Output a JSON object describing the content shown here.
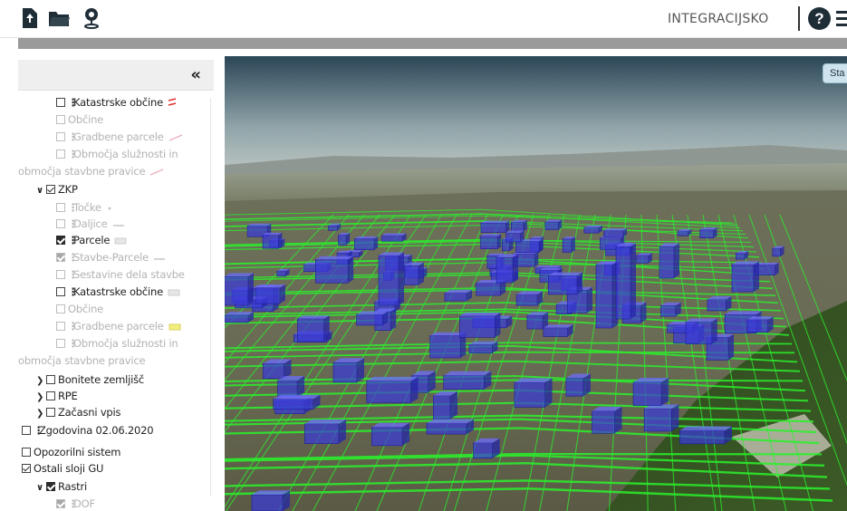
{
  "toolbar": {
    "mode_label": "INTEGRACIJSKO",
    "help_label": "?",
    "icons": [
      "upload-file-icon",
      "folder-open-icon",
      "location-pin-icon",
      "help-icon",
      "menu-icon"
    ]
  },
  "panel": {
    "collapse_label": "«"
  },
  "tree": {
    "rows": [
      {
        "label": "Katastrske občine",
        "state": "dark",
        "check": "none",
        "chevron": "",
        "kebab": true,
        "legend": "red-dash",
        "indent": 2
      },
      {
        "label": "Občine",
        "state": "dim",
        "check": "none",
        "chevron": "",
        "kebab": false,
        "legend": "",
        "indent": 2
      },
      {
        "label": "Gradbene parcele",
        "state": "dim",
        "check": "none",
        "chevron": "",
        "kebab": true,
        "legend": "pink-line",
        "indent": 2
      },
      {
        "label": "Območja služnosti in",
        "state": "dim",
        "check": "none",
        "chevron": "",
        "kebab": true,
        "legend": "",
        "indent": 2
      },
      {
        "label": "območja stavbne pravice",
        "state": "dim",
        "check": "",
        "chevron": "",
        "kebab": false,
        "legend": "pink-line",
        "indent": 0
      },
      {
        "label": "ZKP",
        "state": "dark",
        "check": "outline",
        "chevron": "down",
        "kebab": false,
        "legend": "",
        "indent": 1
      },
      {
        "label": "Točke",
        "state": "dim",
        "check": "none",
        "chevron": "",
        "kebab": true,
        "legend": "dot",
        "indent": 2
      },
      {
        "label": "Daljice",
        "state": "dim",
        "check": "none",
        "chevron": "",
        "kebab": true,
        "legend": "grey-line",
        "indent": 2
      },
      {
        "label": "Parcele",
        "state": "dark",
        "check": "checked",
        "chevron": "",
        "kebab": true,
        "legend": "grey-box",
        "indent": 2
      },
      {
        "label": "Stavbe-Parcele",
        "state": "dim",
        "check": "checked-dim",
        "chevron": "",
        "kebab": true,
        "legend": "grey-line",
        "indent": 2
      },
      {
        "label": "Sestavine dela stavbe",
        "state": "dim",
        "check": "none",
        "chevron": "",
        "kebab": true,
        "legend": "",
        "indent": 2
      },
      {
        "label": "Katastrske občine",
        "state": "dark",
        "check": "none",
        "chevron": "",
        "kebab": true,
        "legend": "grey-box",
        "indent": 2
      },
      {
        "label": "Občine",
        "state": "dim",
        "check": "none",
        "chevron": "",
        "kebab": false,
        "legend": "",
        "indent": 2
      },
      {
        "label": "Gradbene parcele",
        "state": "dim",
        "check": "none",
        "chevron": "",
        "kebab": true,
        "legend": "yellow-box",
        "indent": 2
      },
      {
        "label": "Območja služnosti in",
        "state": "dim",
        "check": "none",
        "chevron": "",
        "kebab": true,
        "legend": "",
        "indent": 2
      },
      {
        "label": "območja stavbne pravice",
        "state": "dim",
        "check": "",
        "chevron": "",
        "kebab": false,
        "legend": "",
        "indent": 0.7
      },
      {
        "label": "Bonitete zemljišč",
        "state": "dark",
        "check": "none",
        "chevron": "right",
        "kebab": false,
        "legend": "",
        "indent": 1
      },
      {
        "label": "RPE",
        "state": "dark",
        "check": "none",
        "chevron": "right",
        "kebab": false,
        "legend": "",
        "indent": 1
      },
      {
        "label": "Začasni vpis",
        "state": "dark",
        "check": "none",
        "chevron": "right",
        "kebab": false,
        "legend": "",
        "indent": 1
      },
      {
        "label": "Zgodovina 02.06.2020",
        "state": "dark",
        "check": "none",
        "chevron": "",
        "kebab": true,
        "legend": "",
        "indent": 0
      },
      {
        "label": "Opozorilni sistem",
        "state": "dark",
        "check": "none",
        "chevron": "",
        "kebab": false,
        "legend": "",
        "indent": 0
      },
      {
        "label": "Ostali sloji GU",
        "state": "dark",
        "check": "outline",
        "chevron": "",
        "kebab": false,
        "legend": "",
        "indent": 0
      },
      {
        "label": "Rastri",
        "state": "dark",
        "check": "checked",
        "chevron": "down",
        "kebab": false,
        "legend": "",
        "indent": 1
      },
      {
        "label": "DOF",
        "state": "dim",
        "check": "checked-dim",
        "chevron": "",
        "kebab": true,
        "legend": "",
        "indent": 2
      }
    ]
  },
  "map": {
    "stat_button_label": "Sta"
  },
  "colors": {
    "building": "#3a3ad8",
    "parcel_line": "#2bf02b",
    "sky_top": "#2d4a5c",
    "terrain": "#58623f"
  }
}
